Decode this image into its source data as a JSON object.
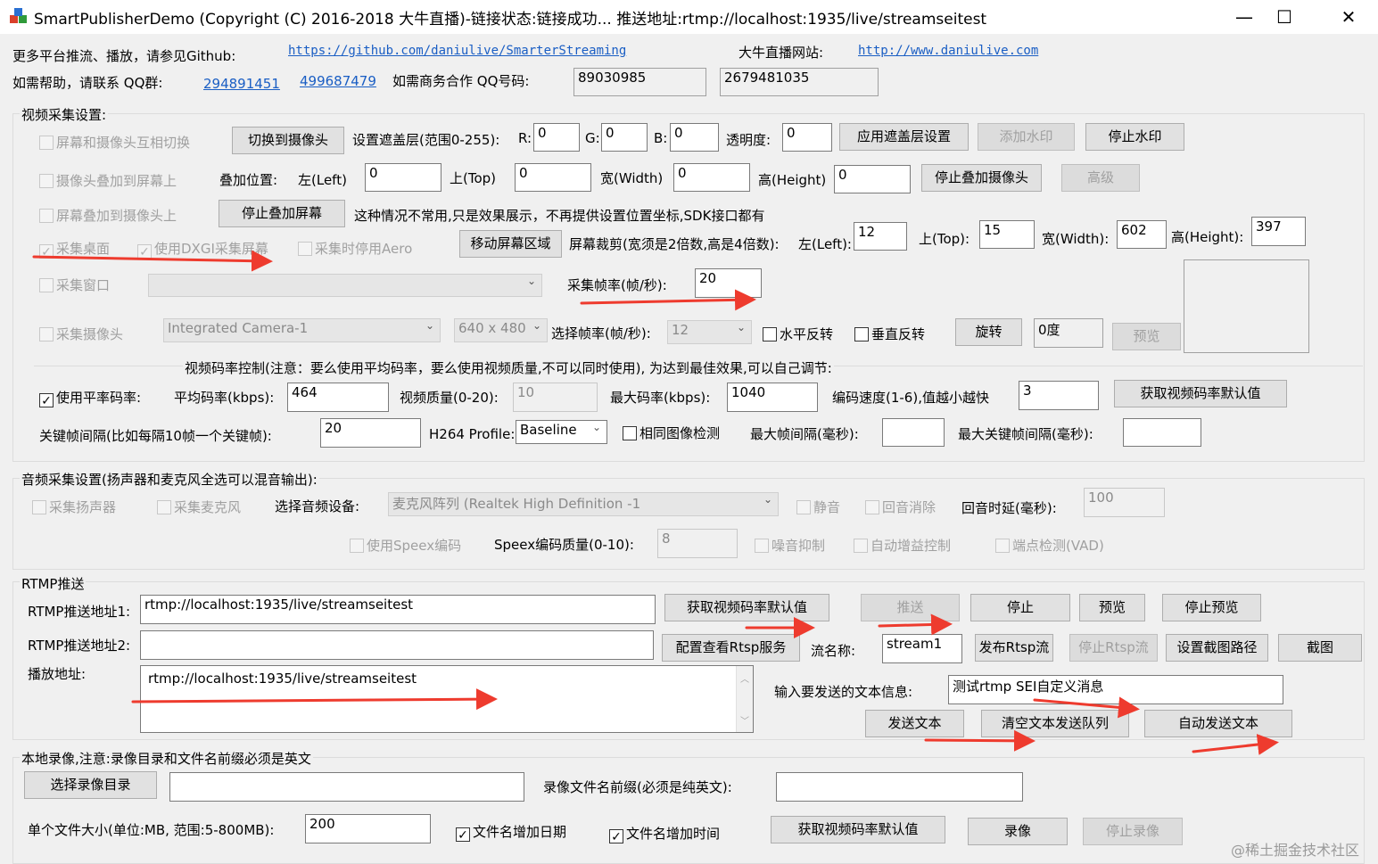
{
  "window": {
    "title": "SmartPublisherDemo  (Copyright (C) 2016-2018 大牛直播)-链接状态:链接成功... 推送地址:rtmp://localhost:1935/live/streamseitest",
    "minimize": "—",
    "maximize": "☐",
    "close": "✕"
  },
  "info": {
    "more_platforms": "更多平台推流、播放，请参见Github:",
    "github_url": "https://github.com/daniulive/SmarterStreaming",
    "site_label": "大牛直播网站:",
    "site_url": "http://www.daniulive.com",
    "help_label": "如需帮助，请联系 QQ群:",
    "qq_group1": "294891451",
    "qq_group2": "499687479",
    "biz_label": "如需商务合作 QQ号码:",
    "qq1": "89030985",
    "qq2": "2679481035"
  },
  "video": {
    "group_label": "视频采集设置:",
    "switch_screen_cam": "屏幕和摄像头互相切换",
    "switch_to_cam_btn": "切换到摄像头",
    "overlay_range_label": "设置遮盖层(范围0-255):",
    "r_label": "R:",
    "r_value": "0",
    "g_label": "G:",
    "g_value": "0",
    "b_label": "B:",
    "b_value": "0",
    "alpha_label": "透明度:",
    "alpha_value": "0",
    "apply_overlay_btn": "应用遮盖层设置",
    "add_watermark_btn": "添加水印",
    "stop_watermark_btn": "停止水印",
    "cam_on_screen": "摄像头叠加到屏幕上",
    "overlay_pos_label": "叠加位置:",
    "left_label": "左(Left)",
    "left_value": "0",
    "top_label": "上(Top)",
    "top_value": "0",
    "width_label": "宽(Width)",
    "width_value": "0",
    "height_label": "高(Height)",
    "height_value": "0",
    "stop_overlay_cam_btn": "停止叠加摄像头",
    "advanced_btn": "高级",
    "screen_on_cam": "屏幕叠加到摄像头上",
    "stop_overlay_screen_btn": "停止叠加屏幕",
    "note_text": "这种情况不常用,只是效果展示，不再提供设置位置坐标,SDK接口都有",
    "capture_desktop": "采集桌面",
    "use_dxgi": "使用DXGI采集屏幕",
    "disable_aero": "采集时停用Aero",
    "move_region_btn": "移动屏幕区域",
    "crop_label": "屏幕裁剪(宽须是2倍数,高是4倍数):",
    "crop_left_label": "左(Left):",
    "crop_left": "12",
    "crop_top_label": "上(Top):",
    "crop_top": "15",
    "crop_width_label": "宽(Width):",
    "crop_width": "602",
    "crop_height_label": "高(Height):",
    "crop_height": "397",
    "capture_window": "采集窗口",
    "fps_label": "采集帧率(帧/秒):",
    "fps_value": "20",
    "capture_camera": "采集摄像头",
    "camera_device": "Integrated Camera-1",
    "resolution": "640 x 480",
    "select_fps_label": "选择帧率(帧/秒):",
    "select_fps": "12",
    "flip_h": "水平反转",
    "flip_v": "垂直反转",
    "rotate_btn": "旋转",
    "rotate_value": "0度",
    "preview_btn": "预览",
    "bitrate_note": "视频码率控制(注意：要么使用平均码率，要么使用视频质量,不可以同时使用), 为达到最佳效果,可以自己调节:",
    "use_avg_bitrate": "使用平率码率:",
    "avg_bitrate_label": "平均码率(kbps):",
    "avg_bitrate": "464",
    "quality_label": "视频质量(0-20):",
    "quality": "10",
    "max_bitrate_label": "最大码率(kbps):",
    "max_bitrate": "1040",
    "speed_label": "编码速度(1-6),值越小越快",
    "speed": "3",
    "get_default_bitrate_btn": "获取视频码率默认值",
    "keyframe_label": "关键帧间隔(比如每隔10帧一个关键帧):",
    "keyframe": "20",
    "profile_label": "H264 Profile:",
    "profile": "Baseline",
    "same_image_detect": "相同图像检测",
    "max_frame_interval_label": "最大帧间隔(毫秒):",
    "max_keyframe_interval_label": "最大关键帧间隔(毫秒):"
  },
  "audio": {
    "group_label": "音频采集设置(扬声器和麦克风全选可以混音输出):",
    "capture_speaker": "采集扬声器",
    "capture_mic": "采集麦克风",
    "select_device_label": "选择音频设备:",
    "device": "麦克风阵列 (Realtek High Definition -1",
    "mute": "静音",
    "echo_cancel": "回音消除",
    "echo_delay_label": "回音时延(毫秒):",
    "echo_delay": "100",
    "use_speex": "使用Speex编码",
    "speex_quality_label": "Speex编码质量(0-10):",
    "speex_quality": "8",
    "noise_suppress": "噪音抑制",
    "agc": "自动增益控制",
    "vad": "端点检测(VAD)"
  },
  "rtmp": {
    "group_label": "RTMP推送",
    "url1_label": "RTMP推送地址1:",
    "url1": "rtmp://localhost:1935/live/streamseitest",
    "get_default_bitrate_btn": "获取视频码率默认值",
    "push_btn": "推送",
    "stop_btn": "停止",
    "preview_btn": "预览",
    "stop_preview_btn": "停止预览",
    "url2_label": "RTMP推送地址2:",
    "rtsp_config_btn": "配置查看Rtsp服务",
    "stream_name_label": "流名称:",
    "stream_name": "stream1",
    "publish_rtsp_btn": "发布Rtsp流",
    "stop_rtsp_btn": "停止Rtsp流",
    "snapshot_path_btn": "设置截图路径",
    "snapshot_btn": "截图",
    "play_label": "播放地址:",
    "play_url": "rtmp://localhost:1935/live/streamseitest",
    "text_msg_label": "输入要发送的文本信息:",
    "text_msg": "测试rtmp SEI自定义消息",
    "send_text_btn": "发送文本",
    "clear_text_btn": "清空文本发送队列",
    "auto_send_btn": "自动发送文本"
  },
  "record": {
    "group_label": "本地录像,注意:录像目录和文件名前缀必须是英文",
    "select_dir_btn": "选择录像目录",
    "prefix_label": "录像文件名前缀(必须是纯英文):",
    "file_size_label": "单个文件大小(单位:MB, 范围:5-800MB):",
    "file_size": "200",
    "add_date": "文件名增加日期",
    "add_time": "文件名增加时间",
    "get_default_bitrate_btn": "获取视频码率默认值",
    "record_btn": "录像",
    "stop_record_btn": "停止录像"
  },
  "watermark": "@稀土掘金技术社区",
  "colors": {
    "arrow": "#ee3b2e",
    "link": "#1a5ec4"
  }
}
